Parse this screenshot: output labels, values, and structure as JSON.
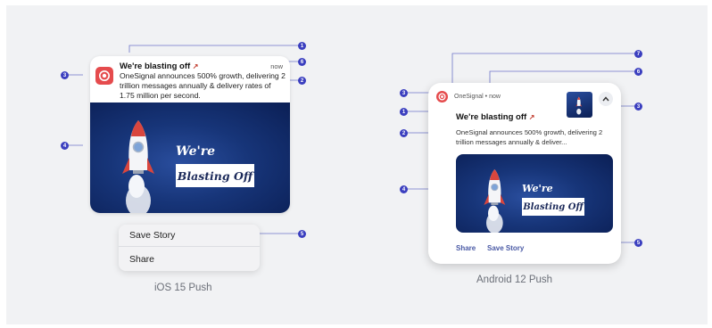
{
  "ios": {
    "title": "We're blasting off",
    "timestamp": "now",
    "body": "OneSignal announces 500% growth, delivering 2 trillion messages annually & delivery rates of 1.75 million per second.",
    "hero_line1": "We're",
    "hero_line2": "Blasting Off",
    "menu": [
      "Save Story",
      "Share"
    ],
    "caption": "iOS 15 Push"
  },
  "android": {
    "app_name": "OneSignal",
    "timestamp": "now",
    "title": "We're blasting off",
    "body": "OneSignal announces 500% growth, delivering 2 trillion messages annually & deliver...",
    "hero_line1": "We're",
    "hero_line2": "Blasting Off",
    "actions": [
      "Share",
      "Save Story"
    ],
    "caption": "Android 12 Push"
  },
  "markers": {
    "ios": [
      "1",
      "6",
      "3",
      "2",
      "4",
      "5"
    ],
    "android": [
      "7",
      "6",
      "3",
      "3",
      "1",
      "2",
      "4",
      "5"
    ]
  },
  "colors": {
    "marker": "#3b3fbf",
    "app_icon": "#e54b4d",
    "hero_dark": "#0b1f55",
    "android_action": "#4a5aa5"
  },
  "icons": [
    "rocket-emoji-icon",
    "onesignal-app-icon",
    "rocket-icon",
    "chevron-up-icon"
  ]
}
